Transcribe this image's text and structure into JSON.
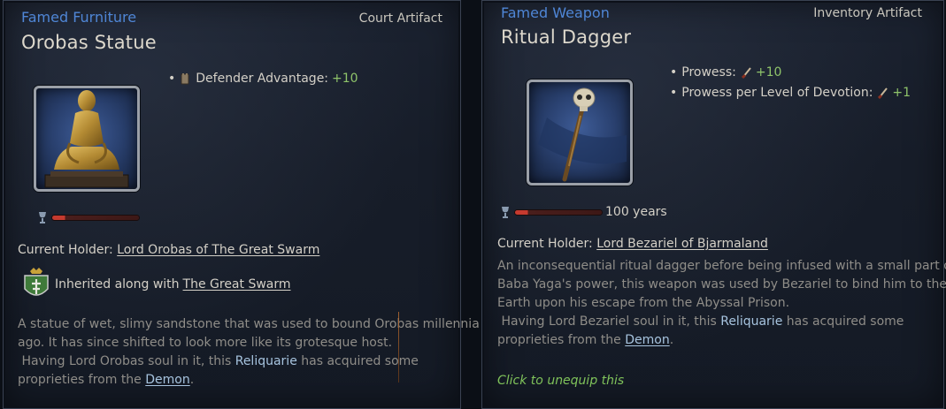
{
  "left": {
    "category": "Famed Furniture",
    "type": "Court Artifact",
    "title": "Orobas Statue",
    "modifiers": [
      {
        "icon": "fortification-icon",
        "label": "Defender Advantage:",
        "value": "+10"
      }
    ],
    "holder_label": "Current Holder:",
    "holder_name": "Lord Orobas of The Great Swarm",
    "inherit_prefix": "Inherited along with",
    "inherit_link": "The Great Swarm",
    "desc": {
      "line1": "A statue of wet, slimy sandstone that was used to bound Orobas millennia",
      "line2": "ago. It has since shifted to look more like its grotesque host.",
      "line3_pre": "Having Lord Orobas soul in it, this",
      "line3_hl": "Reliquarie",
      "line3_post": "has acquired some",
      "line4_pre": "proprieties from the",
      "line4_link": "Demon",
      "line4_post": "."
    },
    "colors": {
      "category": "#4f86d6",
      "positive": "#8fc46a"
    }
  },
  "right": {
    "category": "Famed Weapon",
    "type": "Inventory Artifact",
    "title": "Ritual Dagger",
    "modifiers": [
      {
        "icon": "prowess-icon",
        "label": "Prowess:",
        "value": "+10"
      },
      {
        "icon": "prowess-icon",
        "label": "Prowess per Level of Devotion:",
        "value": "+1"
      }
    ],
    "durability": "100 years",
    "holder_label": "Current Holder:",
    "holder_name": "Lord Bezariel of Bjarmaland",
    "desc": {
      "line1": "An inconsequential ritual dagger before being infused with a small part of",
      "line2": "Baba Yaga's power, this weapon was used by Bezariel to bind him to the",
      "line3": "Earth upon his escape from the Abyssal Prison.",
      "line4_pre": "Having Lord Bezariel soul in it, this",
      "line4_hl": "Reliquarie",
      "line4_post": "has acquired some",
      "line5_pre": "proprieties from the",
      "line5_link": "Demon",
      "line5_post": "."
    },
    "hint": "Click to unequip this"
  }
}
